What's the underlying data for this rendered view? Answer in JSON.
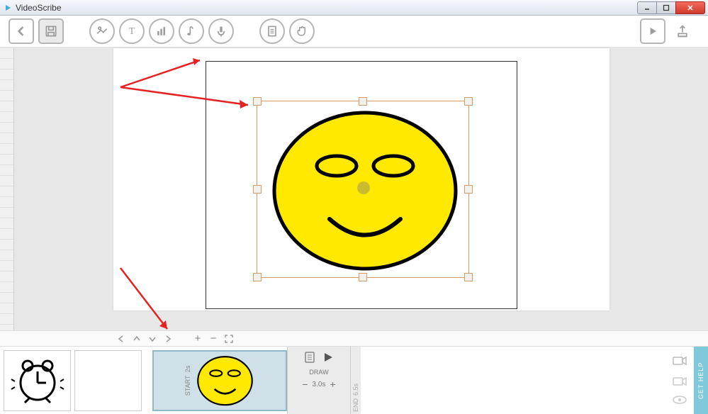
{
  "window": {
    "title": "VideoScribe"
  },
  "toolbar": {
    "back": "back",
    "save": "save",
    "image": "add-image",
    "text": "add-text",
    "chart": "add-chart",
    "music": "add-music",
    "voice": "record-voice",
    "paper": "paper",
    "hand": "hand",
    "play": "preview-play",
    "export": "export"
  },
  "nav": {
    "zoom_in": "+",
    "zoom_out": "−"
  },
  "timeline": {
    "start_label": "START",
    "start_time": "2s",
    "draw_label": "DRAW",
    "duration": "3.0s",
    "end_label": "END",
    "end_time": "6.5s",
    "minus": "−",
    "plus": "+"
  },
  "sidebar": {
    "get_help": "GET HELP"
  }
}
